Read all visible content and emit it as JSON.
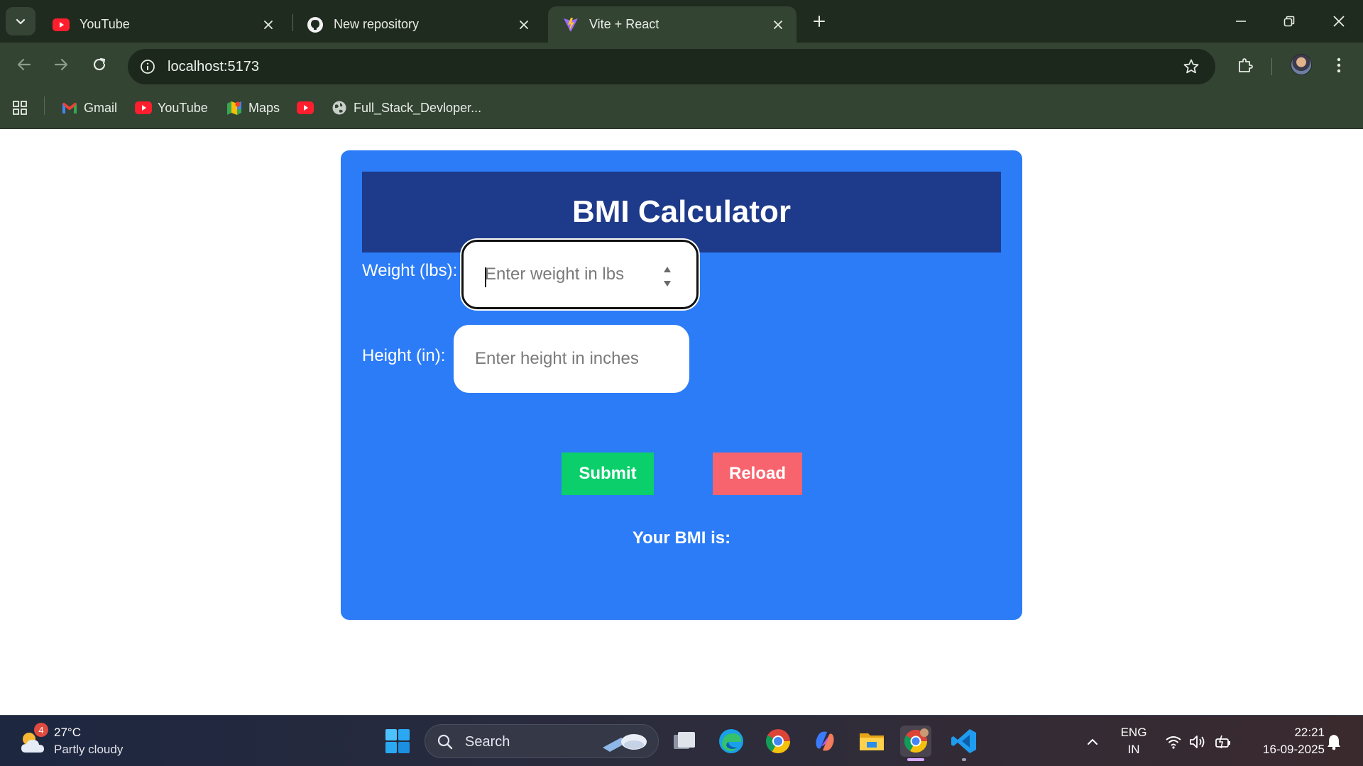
{
  "browser": {
    "tabs": [
      {
        "title": "YouTube",
        "icon": "youtube-icon",
        "active": false
      },
      {
        "title": "New repository",
        "icon": "github-icon",
        "active": false
      },
      {
        "title": "Vite + React",
        "icon": "vite-icon",
        "active": true
      }
    ],
    "url": "localhost:5173",
    "bookmarks": [
      {
        "label": "Gmail",
        "icon": "gmail-icon"
      },
      {
        "label": "YouTube",
        "icon": "youtube-icon"
      },
      {
        "label": "Maps",
        "icon": "maps-icon"
      },
      {
        "label": "",
        "icon": "youtube-icon"
      },
      {
        "label": "Full_Stack_Devloper...",
        "icon": "globe-icon"
      }
    ]
  },
  "app": {
    "title": "BMI Calculator",
    "weight_label": "Weight (lbs):",
    "weight_placeholder": "Enter weight in lbs",
    "height_label": "Height (in):",
    "height_placeholder": "Enter height in inches",
    "submit_label": "Submit",
    "reload_label": "Reload",
    "result_label": "Your BMI is:"
  },
  "colors": {
    "card": "#2c7cf7",
    "header": "#1e3a8a",
    "submit": "#0acf6b",
    "reload": "#f7646e"
  },
  "taskbar": {
    "weather_temp": "27°C",
    "weather_desc": "Partly cloudy",
    "weather_badge": "4",
    "search_label": "Search",
    "lang_top": "ENG",
    "lang_bottom": "IN",
    "time": "22:21",
    "date": "16-09-2025"
  }
}
